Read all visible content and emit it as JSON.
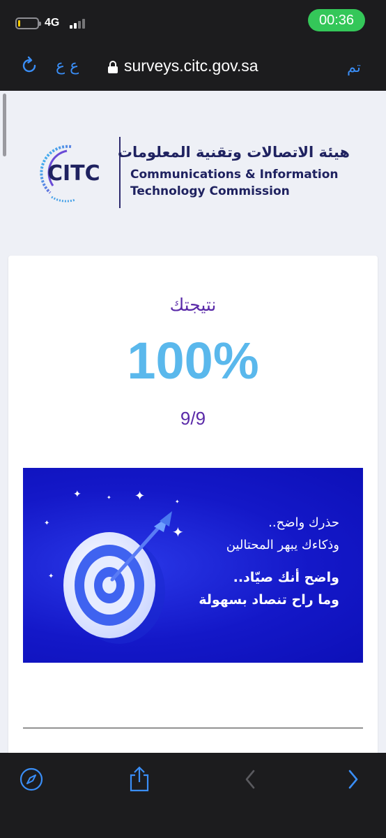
{
  "status_bar": {
    "network": "4G",
    "time": "00:36"
  },
  "browser": {
    "text_size_label": "ع ع",
    "url": "surveys.citc.gov.sa",
    "done_label": "تم"
  },
  "logo": {
    "abbr": "CITC",
    "arabic_name": "هيئة الاتصالات وتقنية المعلومات",
    "english_line1": "Communications & Information",
    "english_line2": "Technology Commission"
  },
  "result": {
    "label": "نتيجتك",
    "percent": "100%",
    "score": "9/9"
  },
  "banner": {
    "line1": "حذرك واضح..",
    "line2": "وذكاءك يبهر المحتالين",
    "line3": "واضح أنك صيّاد..",
    "line4": "وما راح تنصاد بسهولة"
  },
  "toolbar": {
    "items": [
      "compass-icon",
      "share-icon",
      "back-icon",
      "forward-icon"
    ]
  },
  "colors": {
    "accent": "#3a8ef7",
    "status_green": "#34c759",
    "purple": "#5a2aa8",
    "percent_blue": "#5ab8ec",
    "banner_blue": "#1418c8"
  }
}
